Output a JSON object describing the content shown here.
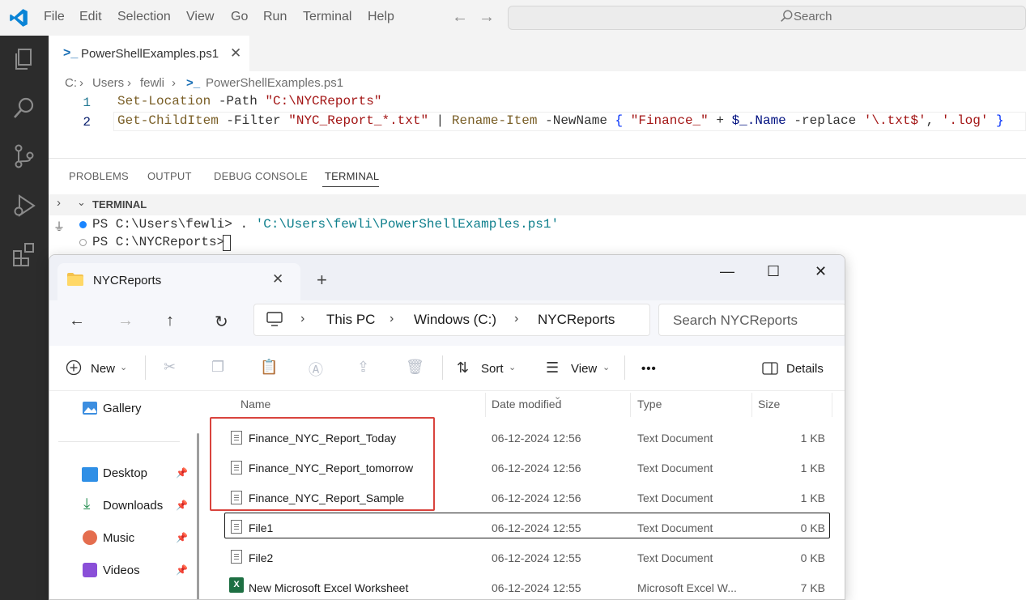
{
  "vscode": {
    "menu": [
      "File",
      "Edit",
      "Selection",
      "View",
      "Go",
      "Run",
      "Terminal",
      "Help"
    ],
    "search_label": "Search",
    "tab": {
      "label": "PowerShellExamples.ps1",
      "close": "✕"
    },
    "breadcrumb": [
      "C:",
      "Users",
      "fewli",
      "PowerShellExamples.ps1"
    ],
    "code": {
      "line_numbers": [
        "1",
        "2"
      ],
      "line1": {
        "cmd": "Set-Location",
        "param": " -Path ",
        "str": "\"C:\\NYCReports\""
      },
      "line2": {
        "cmd1": "Get-ChildItem",
        "param1": " -Filter ",
        "str1": "\"NYC_Report_*.txt\"",
        "pipe": " | ",
        "cmd2": "Rename-Item",
        "param2": " -NewName ",
        "brace_open": "{ ",
        "str2": "\"Finance_\"",
        "plus": " + ",
        "var": "$_.Name",
        "param3": " -replace ",
        "str3": "'\\.txt$'",
        "comma": ", ",
        "str4": "'.log'",
        "brace_close": " }"
      }
    },
    "panel_tabs": [
      "PROBLEMS",
      "OUTPUT",
      "DEBUG CONSOLE",
      "TERMINAL"
    ],
    "terminal_header": "TERMINAL",
    "terminal": {
      "line1_prompt": "PS C:\\Users\\fewli> ",
      "line1_dot": ". ",
      "line1_arg": "'C:\\Users\\fewli\\PowerShellExamples.ps1'",
      "line2_prompt": "PS C:\\NYCReports> "
    }
  },
  "explorer": {
    "tab_title": "NYCReports",
    "tab_close": "✕",
    "new_tab": "+",
    "window_controls": [
      "—",
      "☐",
      "✕"
    ],
    "nav": [
      "←",
      "→",
      "↑",
      "↻"
    ],
    "address": [
      "This PC",
      "Windows (C:)",
      "NYCReports"
    ],
    "search_placeholder": "Search NYCReports",
    "commands": {
      "new": "New",
      "sort": "Sort",
      "view": "View",
      "more": "•••",
      "details": "Details"
    },
    "nav_pane": [
      {
        "label": "Gallery",
        "pinned": false
      },
      {
        "label": "Desktop",
        "pinned": true
      },
      {
        "label": "Downloads",
        "pinned": true
      },
      {
        "label": "Music",
        "pinned": true
      },
      {
        "label": "Videos",
        "pinned": true
      }
    ],
    "columns": [
      "Name",
      "Date modified",
      "Type",
      "Size"
    ],
    "files": [
      {
        "name": "Finance_NYC_Report_Today",
        "date": "06-12-2024 12:56",
        "type": "Text Document",
        "size": "1 KB"
      },
      {
        "name": "Finance_NYC_Report_tomorrow",
        "date": "06-12-2024 12:56",
        "type": "Text Document",
        "size": "1 KB"
      },
      {
        "name": "Finance_NYC_Report_Sample",
        "date": "06-12-2024 12:56",
        "type": "Text Document",
        "size": "1 KB"
      },
      {
        "name": "File1",
        "date": "06-12-2024 12:55",
        "type": "Text Document",
        "size": "0 KB"
      },
      {
        "name": "File2",
        "date": "06-12-2024 12:55",
        "type": "Text Document",
        "size": "0 KB"
      },
      {
        "name": "New Microsoft Excel Worksheet",
        "date": "06-12-2024 12:55",
        "type": "Microsoft Excel W...",
        "size": "7 KB"
      }
    ],
    "colors": {
      "highlight": "#d9433d",
      "accent": "#0067c0"
    }
  }
}
